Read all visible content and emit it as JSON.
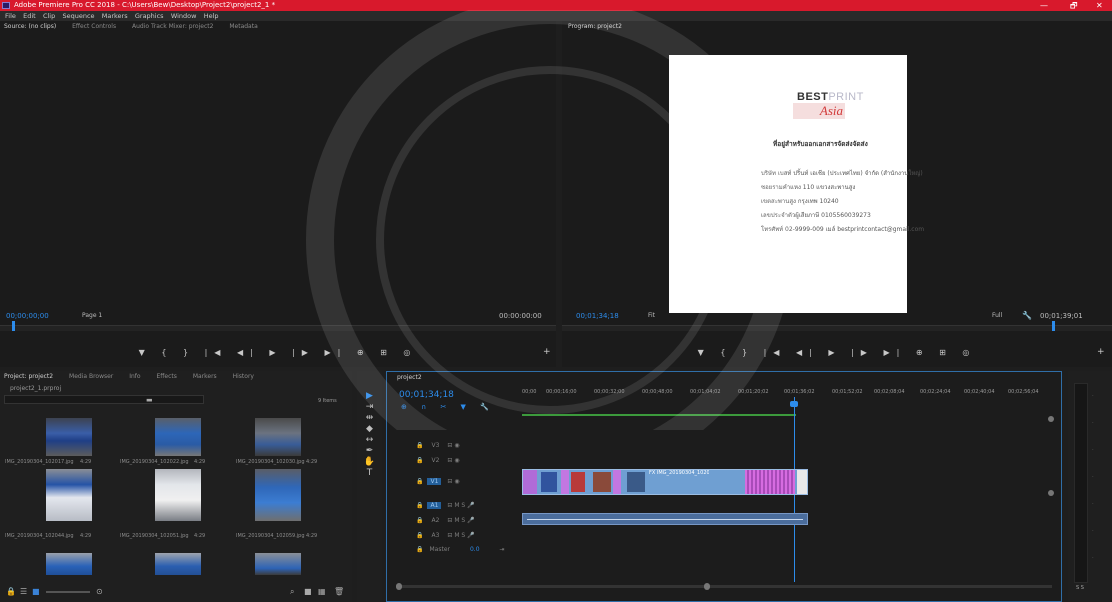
{
  "window": {
    "title": "Adobe Premiere Pro CC 2018 - C:\\Users\\Bew\\Desktop\\Project2\\project2_1 *",
    "min": "—",
    "max": "🗗",
    "close": "✕"
  },
  "menu": [
    "File",
    "Edit",
    "Clip",
    "Sequence",
    "Markers",
    "Graphics",
    "Window",
    "Help"
  ],
  "source_panel": {
    "tabs": [
      "Source: (no clips)",
      "Effect Controls",
      "Audio Track Mixer: project2",
      "Metadata"
    ],
    "menu_icon": "≡",
    "timecode_left": "00;00;00;00",
    "page": "Page 1",
    "timecode_right": "00:00:00:00",
    "controls": "▼ { } |◀ ◀| ▶ |▶ ▶| ⊕ ⊞ ◎"
  },
  "program_panel": {
    "tab": "Program: project2",
    "menu_icon": "≡",
    "timecode_left": "00;01;34;18",
    "fit": "Fit",
    "zoom": "Full",
    "timecode_right": "00;01;39;01",
    "controls": "▼ { } |◀ ◀| ▶ |▶ ▶| ⊕ ⊞ ◎",
    "document": {
      "brand_best": "BEST",
      "brand_print": "PRINT",
      "brand_asia": "Asia",
      "heading": "ที่อยู่สำหรับออกเอกสารจัดส่งจัดส่ง",
      "lines": [
        "บริษัท เบสท์ ปริ้นท์ เอเชีย (ประเทศไทย) จำกัด (สำนักงานใหญ่)",
        "ซอยรามคำแหง 110 แขวงสะพานสูง",
        "เขตสะพานสูง กรุงเทพ 10240",
        "เลขประจำตัวผู้เสียภาษี 0105560039273",
        "โทรศัพท์ 02-9999-009  เมล์ bestprintcontact@gmail.com"
      ]
    }
  },
  "project_panel": {
    "tabs": [
      "Project: project2",
      "Media Browser",
      "Info",
      "Effects",
      "Markers",
      "History"
    ],
    "project_file": "project2_1.prproj",
    "items_count": "9 Items",
    "search_placeholder": "",
    "items": [
      {
        "name": "IMG_20190304_102017.jpg",
        "dur": "4:29"
      },
      {
        "name": "IMG_20190304_102022.jpg",
        "dur": "4:29"
      },
      {
        "name": "IMG_20190304_102030.jpg",
        "dur": "4:29"
      },
      {
        "name": "IMG_20190304_102044.jpg",
        "dur": "4:29"
      },
      {
        "name": "IMG_20190304_102051.jpg",
        "dur": "4:29"
      },
      {
        "name": "IMG_20190304_102059.jpg",
        "dur": "4:29"
      }
    ]
  },
  "timeline": {
    "tab": "project2",
    "menu_icon": "≡",
    "timecode": "00;01;34;18",
    "ruler": [
      "00;00",
      "00;00;16;00",
      "00;00;32;00",
      "00;00;48;00",
      "00;01;04;02",
      "00;01;20;02",
      "00;01;36;02",
      "00;01;52;02",
      "00;02;08;04",
      "00;02;24;04",
      "00;02;40;04",
      "00;02;56;04"
    ],
    "tracks": [
      "V3",
      "V2",
      "V1",
      "A1",
      "A2",
      "A3"
    ],
    "master": "Master",
    "master_val": "0.0",
    "clip_label": "FX  IMG_20190304_102017.jpg"
  },
  "tools": [
    "▶",
    "⇥",
    "⇹",
    "◆",
    "↔",
    "✒",
    "✋",
    "T"
  ]
}
